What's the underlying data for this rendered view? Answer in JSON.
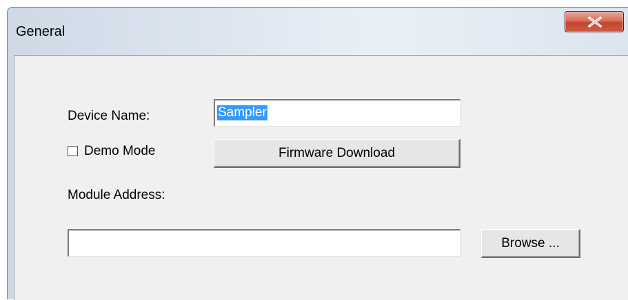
{
  "window": {
    "title": "General",
    "close_glyph": "×"
  },
  "form": {
    "device_name_label": "Device Name:",
    "device_name_value": "Sampler",
    "demo_mode_label": "Demo Mode",
    "demo_mode_checked": false,
    "firmware_button_label": "Firmware Download",
    "module_address_label": "Module Address:",
    "module_address_value": "",
    "browse_button_label": "Browse ..."
  },
  "colors": {
    "selection": "#3399ff",
    "close_button": "#c4442b",
    "dialog_background": "#f0f0f0"
  }
}
